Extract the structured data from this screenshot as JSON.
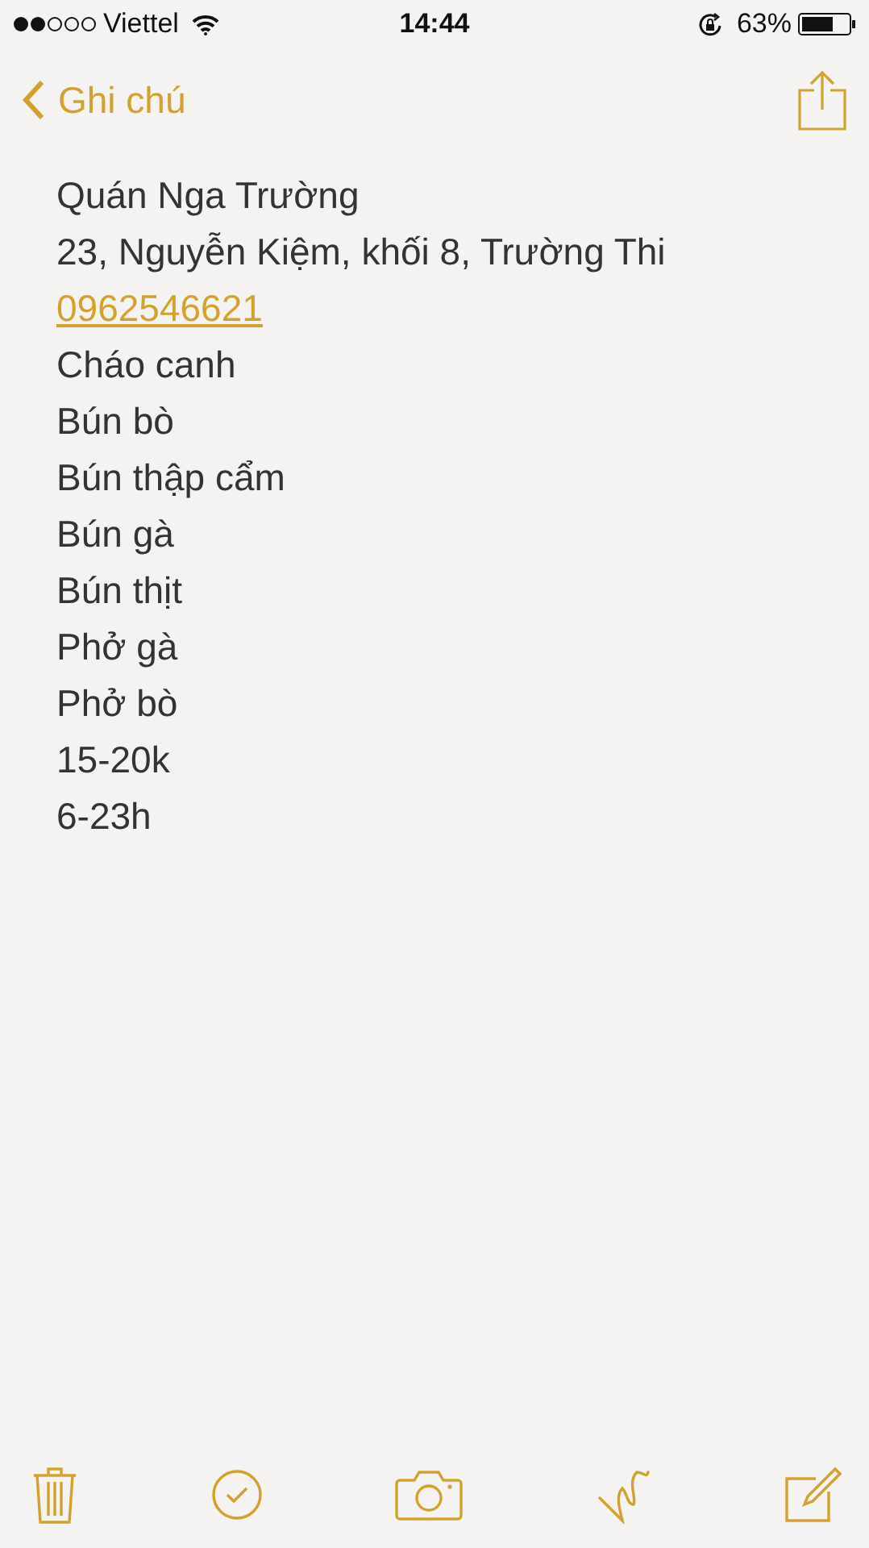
{
  "status_bar": {
    "carrier": "Viettel",
    "time": "14:44",
    "battery": "63%"
  },
  "nav": {
    "back_label": "Ghi chú"
  },
  "note": {
    "lines": [
      {
        "kind": "text",
        "text": "Quán Nga Trường"
      },
      {
        "kind": "text",
        "text": "23, Nguyễn Kiệm, khối 8, Trường Thi"
      },
      {
        "kind": "link",
        "text": "0962546621"
      },
      {
        "kind": "text",
        "text": "Cháo canh"
      },
      {
        "kind": "text",
        "text": "Bún bò"
      },
      {
        "kind": "text",
        "text": "Bún thập cẩm"
      },
      {
        "kind": "text",
        "text": "Bún gà"
      },
      {
        "kind": "text",
        "text": "Bún thịt"
      },
      {
        "kind": "text",
        "text": "Phở gà"
      },
      {
        "kind": "text",
        "text": "Phở bò"
      },
      {
        "kind": "text",
        "text": "15-20k"
      },
      {
        "kind": "text",
        "text": "6-23h"
      }
    ]
  }
}
